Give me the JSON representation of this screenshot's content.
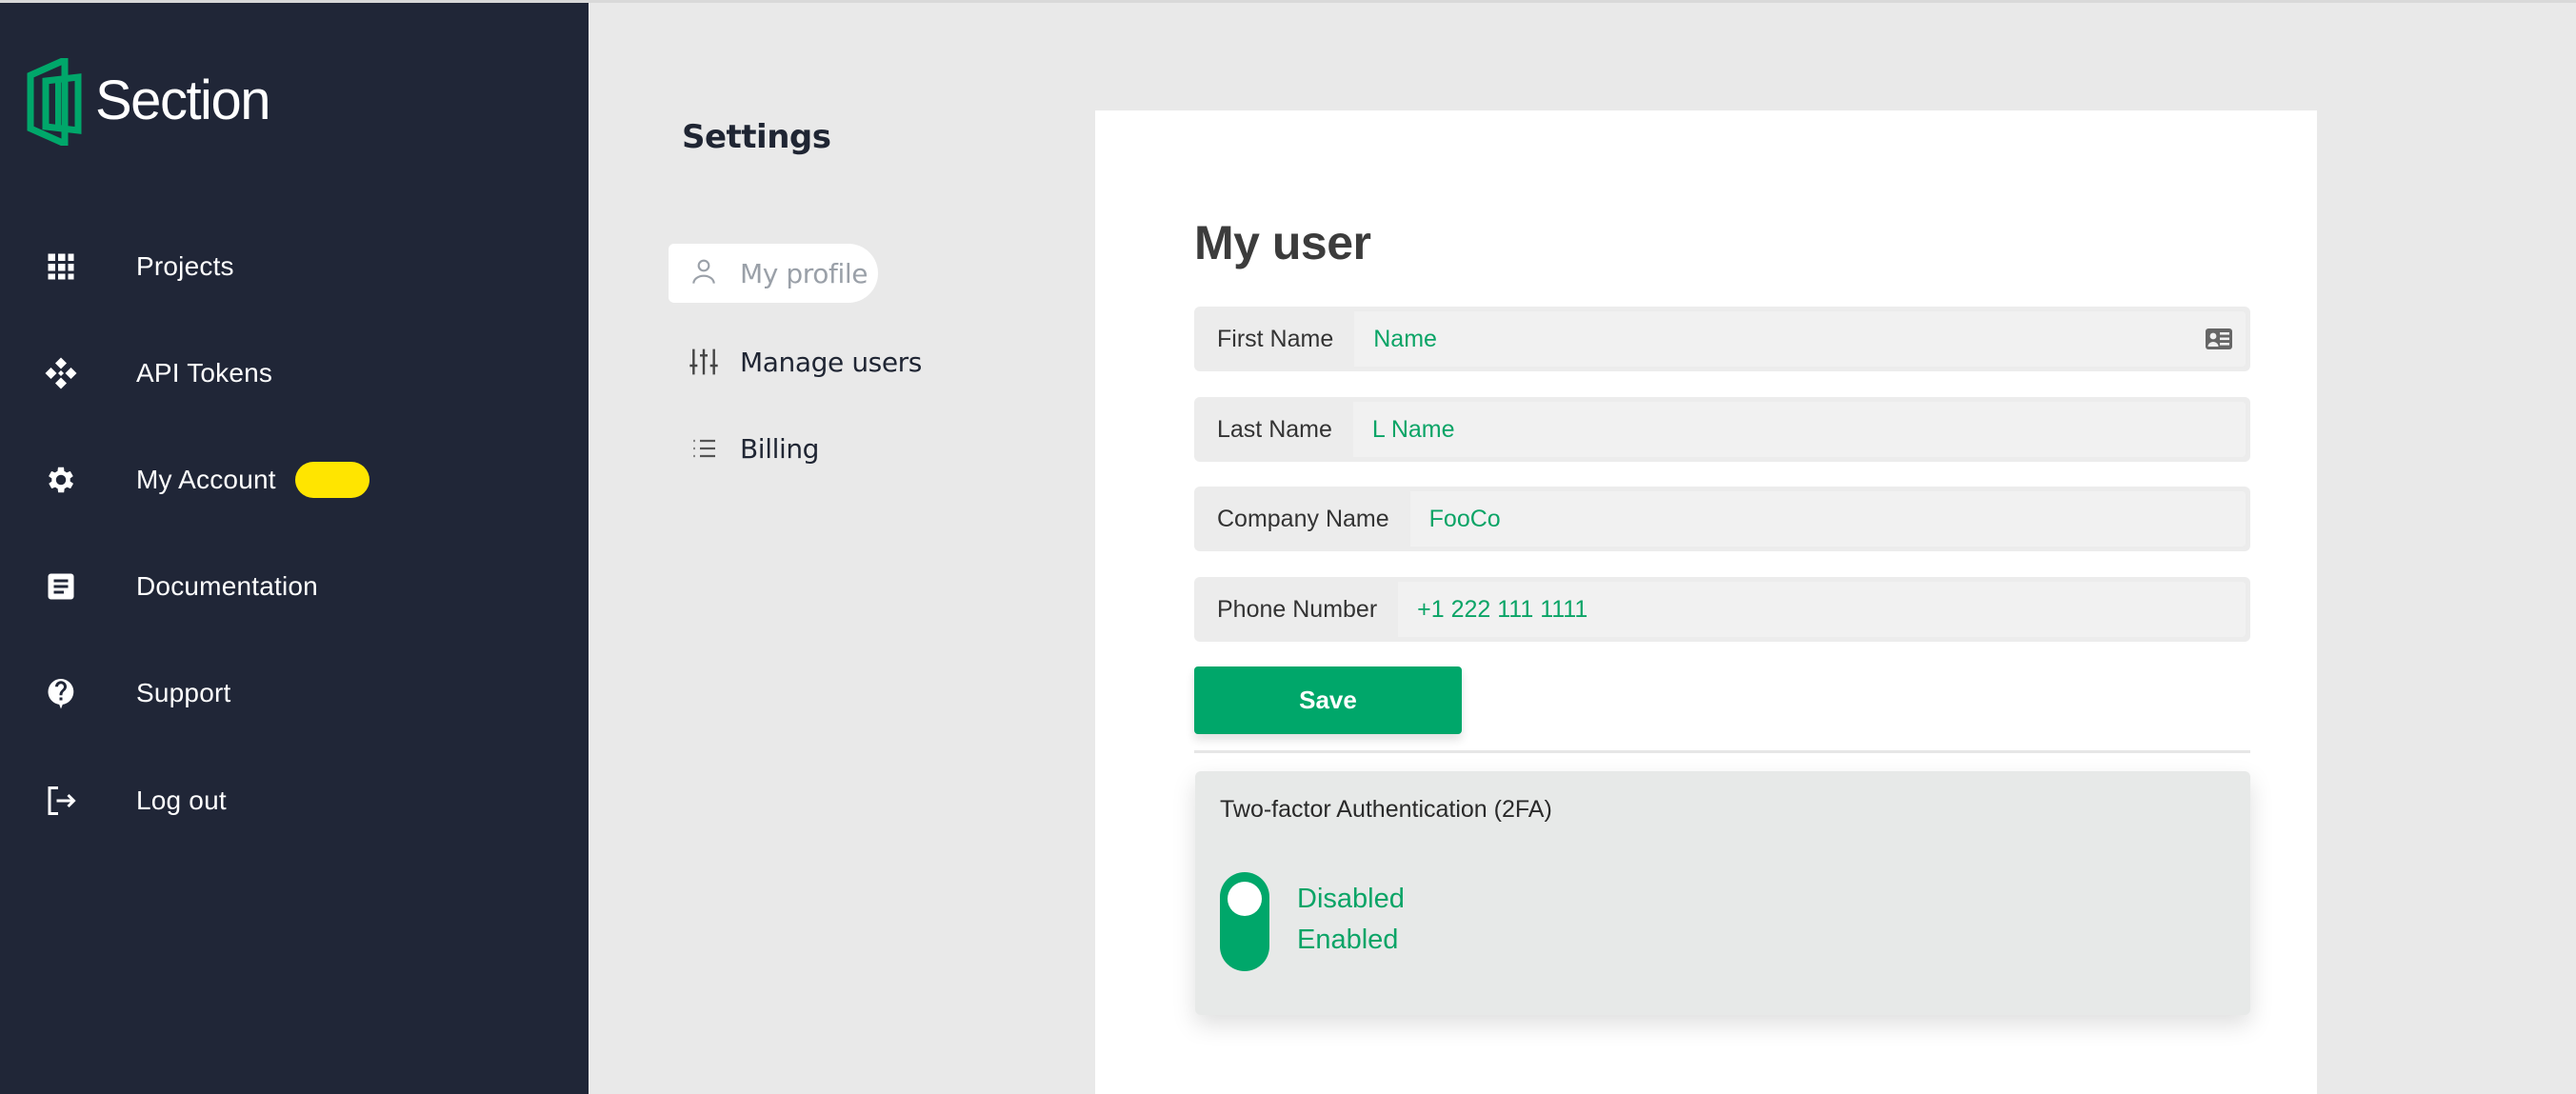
{
  "brand": {
    "name": "Section",
    "accent_color": "#00a76a",
    "sidebar_color": "#202637"
  },
  "sidebar": {
    "items": [
      {
        "label": "Projects",
        "icon": "grid-icon"
      },
      {
        "label": "API Tokens",
        "icon": "token-diamond-icon"
      },
      {
        "label": "My Account",
        "icon": "gear-icon",
        "badge_color": "#ffe500"
      },
      {
        "label": "Documentation",
        "icon": "document-icon"
      },
      {
        "label": "Support",
        "icon": "help-bubble-icon"
      },
      {
        "label": "Log out",
        "icon": "logout-icon"
      }
    ]
  },
  "settings": {
    "title": "Settings",
    "items": [
      {
        "label": "My profile",
        "icon": "user-icon",
        "active": true
      },
      {
        "label": "Manage users",
        "icon": "sliders-icon",
        "active": false
      },
      {
        "label": "Billing",
        "icon": "list-icon",
        "active": false
      }
    ]
  },
  "profile": {
    "title": "My user",
    "fields": [
      {
        "label": "First Name",
        "value": "Name"
      },
      {
        "label": "Last Name",
        "value": "L Name"
      },
      {
        "label": "Company Name",
        "value": "FooCo"
      },
      {
        "label": "Phone Number",
        "value": "+1 222 111 1111"
      }
    ],
    "save_label": "Save"
  },
  "twofa": {
    "title": "Two-factor Authentication (2FA)",
    "options": [
      "Disabled",
      "Enabled"
    ],
    "selected": "Disabled"
  }
}
